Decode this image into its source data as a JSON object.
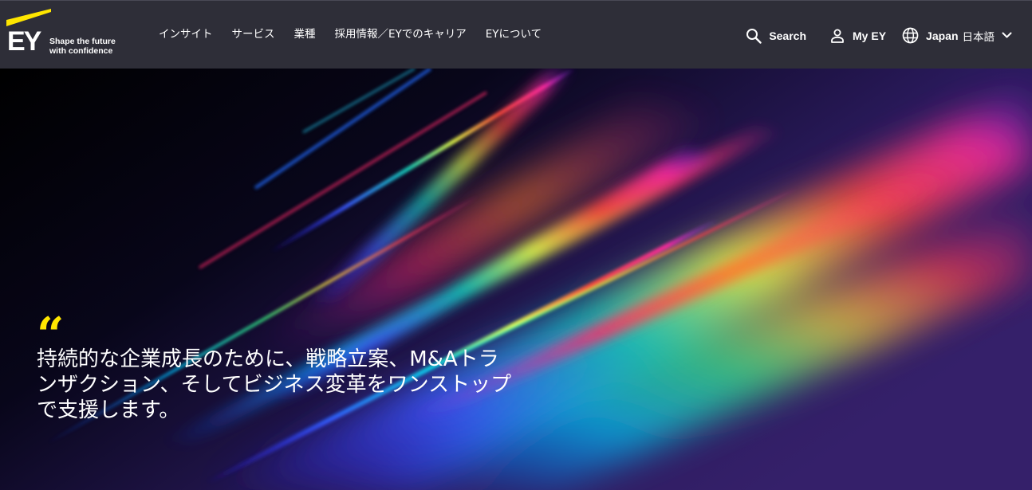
{
  "brand": {
    "logo_text": "EY",
    "tagline_line1": "Shape the future",
    "tagline_line2": "with confidence",
    "accent_color": "#ffe600",
    "header_bg": "#2e2e38"
  },
  "nav": {
    "items": [
      {
        "label": "インサイト"
      },
      {
        "label": "サービス"
      },
      {
        "label": "業種"
      },
      {
        "label": "採用情報／EYでのキャリア"
      },
      {
        "label": "EYについて"
      }
    ]
  },
  "utilities": {
    "search": {
      "label": "Search",
      "icon": "search-icon"
    },
    "my_ey": {
      "label": "My EY",
      "icon": "user-icon"
    },
    "language": {
      "label": "Japan",
      "language": "日本語",
      "icon": "globe-icon",
      "chevron": "chevron-down-icon"
    }
  },
  "hero": {
    "quote_mark": "“",
    "quote": "持続的な企業成長のために、戦略立案、M&Aトランザクション、そしてビジネス変革をワンストップで支援します。"
  }
}
